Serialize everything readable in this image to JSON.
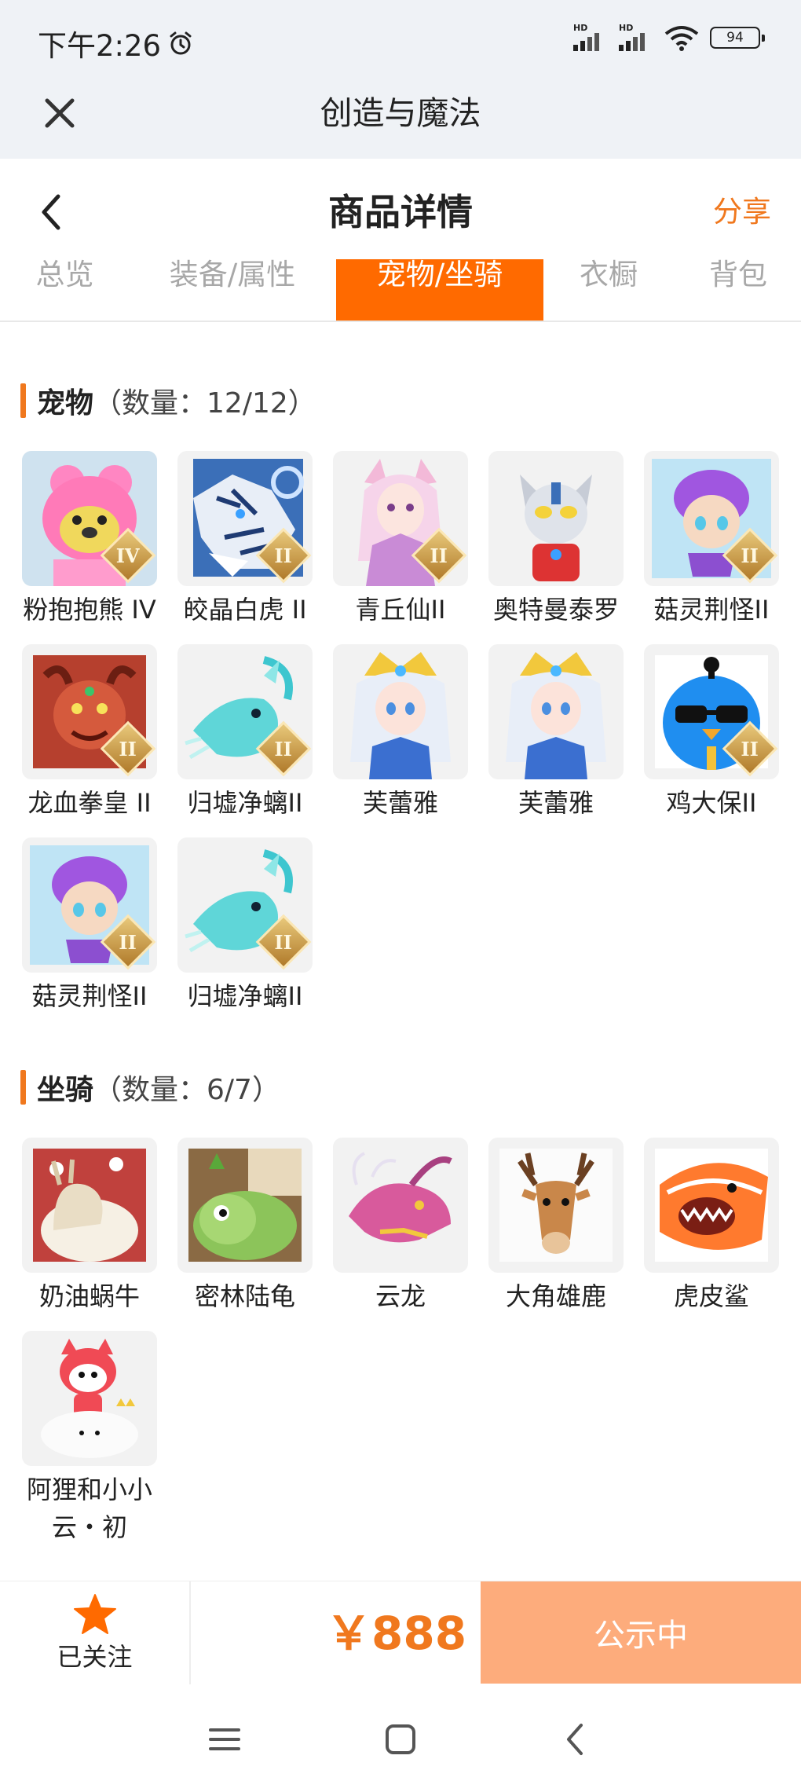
{
  "status_bar": {
    "time": "下午2:26",
    "hd_label_1": "HD",
    "hd_label_2": "HD",
    "battery": "94"
  },
  "app_bar": {
    "title": "创造与魔法"
  },
  "header": {
    "title": "商品详情",
    "share": "分享"
  },
  "tabs": [
    {
      "label": "总览"
    },
    {
      "label": "装备/属性"
    },
    {
      "label": "宠物/坐骑",
      "active": true
    },
    {
      "label": "衣橱"
    },
    {
      "label": "背包"
    }
  ],
  "pets": {
    "name": "宠物",
    "count": "（数量：12/12）",
    "items": [
      {
        "name": "粉抱抱熊 IV",
        "icon": "pink-bear-icon",
        "badge": "IV"
      },
      {
        "name": "皎晶白虎 II",
        "icon": "white-tiger-icon",
        "badge": "II"
      },
      {
        "name": "青丘仙II",
        "icon": "fox-fairy-icon",
        "badge": "II"
      },
      {
        "name": "奥特曼泰罗",
        "icon": "ultraman-icon"
      },
      {
        "name": "菇灵荆怪II",
        "icon": "mushroom-spirit-icon",
        "badge": "II"
      },
      {
        "name": "龙血拳皇 II",
        "icon": "dragon-boxer-icon",
        "badge": "II"
      },
      {
        "name": "归墟净螭II",
        "icon": "jade-dragon-icon",
        "badge": "II"
      },
      {
        "name": "芙蕾雅",
        "icon": "freya-icon"
      },
      {
        "name": "芙蕾雅",
        "icon": "freya-icon"
      },
      {
        "name": "鸡大保II",
        "icon": "chicken-guard-icon",
        "badge": "II"
      },
      {
        "name": "菇灵荆怪II",
        "icon": "mushroom-spirit-icon",
        "badge": "II"
      },
      {
        "name": "归墟净螭II",
        "icon": "jade-dragon-icon",
        "badge": "II"
      }
    ]
  },
  "mounts": {
    "name": "坐骑",
    "count": "（数量：6/7）",
    "items": [
      {
        "name": "奶油蜗牛",
        "icon": "snail-icon"
      },
      {
        "name": "密林陆龟",
        "icon": "turtle-icon"
      },
      {
        "name": "云龙",
        "icon": "cloud-dragon-icon"
      },
      {
        "name": "大角雄鹿",
        "icon": "stag-icon"
      },
      {
        "name": "虎皮鲨",
        "icon": "shark-icon"
      },
      {
        "name": "阿狸和小小云・初",
        "icon": "ali-fox-cloud-icon"
      }
    ]
  },
  "bottom": {
    "follow_label": "已关注",
    "price": "￥888",
    "status": "公示中"
  },
  "colors": {
    "accent": "#ff6a00",
    "orange_text": "#f0781e",
    "status_button": "#fdac7c",
    "top_bg": "#eff2f6"
  }
}
